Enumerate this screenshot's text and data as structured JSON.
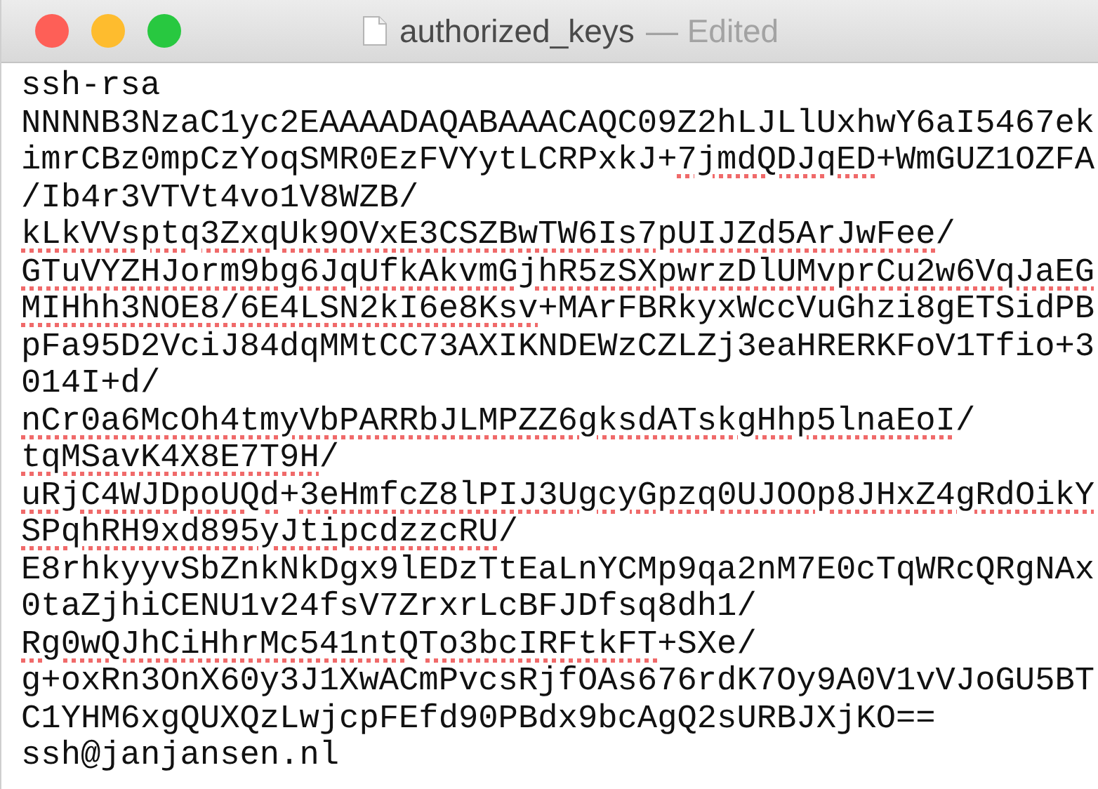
{
  "window": {
    "title": "authorized_keys",
    "status": "— Edited",
    "buttons": [
      {
        "kind": "close"
      },
      {
        "kind": "minimize"
      },
      {
        "kind": "zoom"
      }
    ]
  },
  "lines": [
    [
      {
        "text": "ssh-rsa",
        "misspelled": false
      }
    ],
    [
      {
        "text": "NNNNB3NzaC1yc2EAAAADAQABAAACAQC09Z2hLJLlUxhwY6aI5467ek",
        "misspelled": false
      }
    ],
    [
      {
        "text": "imrCBz0mpCzYoqSMR0EzFVYytLCRPxkJ+",
        "misspelled": false
      },
      {
        "text": "7jmdQDJqED",
        "misspelled": true
      },
      {
        "text": "+WmGUZ1OZFA",
        "misspelled": false
      }
    ],
    [
      {
        "text": "/Ib4r3VTVt4vo1V8WZB/",
        "misspelled": false
      }
    ],
    [
      {
        "text": "kLkVVsptq3ZxqUk9OVxE3CSZBwTW6Is7pUIJZd5ArJwFee",
        "misspelled": true
      },
      {
        "text": "/",
        "misspelled": false
      }
    ],
    [
      {
        "text": "GTuVYZHJorm9bg6JqUfkAkvmGjhR5zSXpwrzDlUMvprCu2w6VqJaEG",
        "misspelled": true
      }
    ],
    [
      {
        "text": "MIHhh3NOE8/6E4LSN2kI6e8Ksv",
        "misspelled": true
      },
      {
        "text": "+MArFBRkyxWccVuGhzi8gETSidPB",
        "misspelled": false
      }
    ],
    [
      {
        "text": "pFa95D2VciJ84dqMMtCC73AXIKNDEWzCZLZj3eaHRERKFoV1Tfio+3",
        "misspelled": false
      }
    ],
    [
      {
        "text": "014I+d/",
        "misspelled": false
      }
    ],
    [
      {
        "text": "nCr0a6McOh4tmyVbPARRbJLMPZZ6gksdATskgHhp5lnaEoI",
        "misspelled": true
      },
      {
        "text": "/",
        "misspelled": false
      }
    ],
    [
      {
        "text": "tqMSavK4X8E7T9H",
        "misspelled": true
      },
      {
        "text": "/",
        "misspelled": false
      }
    ],
    [
      {
        "text": "uRjC4WJDpoUQd",
        "misspelled": true
      },
      {
        "text": "+",
        "misspelled": false
      },
      {
        "text": "3eHmfcZ8lPIJ3UgcyGpzq0UJOOp8JHxZ4gRdOikY",
        "misspelled": true
      }
    ],
    [
      {
        "text": "SPqhRH9xd895yJtipcdzzcRU",
        "misspelled": true
      },
      {
        "text": "/",
        "misspelled": false
      }
    ],
    [
      {
        "text": "E8rhkyyvSbZnkNkDgx9lEDzTtEaLnYCMp9qa2nM7E0cTqWRcQRgNAx",
        "misspelled": false
      }
    ],
    [
      {
        "text": "0taZjhiCENU1v24fsV7ZrxrLcBFJDfsq8dh1/",
        "misspelled": false
      }
    ],
    [
      {
        "text": "Rg0wQJhCiHhrMc541ntQTo3bcIRFtkFT",
        "misspelled": true
      },
      {
        "text": "+SXe/",
        "misspelled": false
      }
    ],
    [
      {
        "text": "g+oxRn3OnX60y3J1XwACmPvcsRjfOAs676rdK7Oy9A0V1vVJoGU5BT",
        "misspelled": false
      }
    ],
    [
      {
        "text": "C1YHM6xgQUXQzLwjcpFEfd90PBdx9bcAgQ2sURBJXjKO==",
        "misspelled": false
      }
    ],
    [
      {
        "text": "ssh@janjansen.nl",
        "misspelled": false
      }
    ]
  ]
}
